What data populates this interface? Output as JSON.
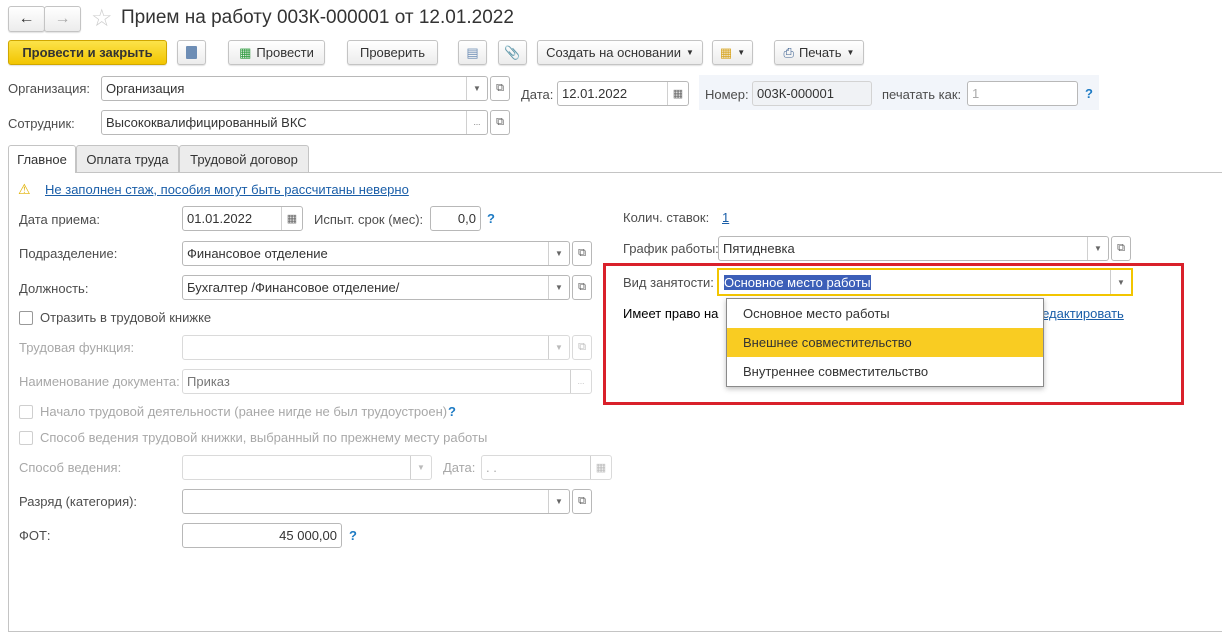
{
  "window": {
    "title": "Прием на работу 003К-000001 от 12.01.2022"
  },
  "toolbar": {
    "post_close": "Провести и закрыть",
    "post": "Провести",
    "check": "Проверить",
    "create_based": "Создать на основании",
    "print": "Печать"
  },
  "header": {
    "org_label": "Организация:",
    "org_value": "Организация",
    "date_label": "Дата:",
    "date_value": "12.01.2022",
    "number_label": "Номер:",
    "number_value": "003К-000001",
    "print_as_label": "печатать как:",
    "print_as_placeholder": "1",
    "help": "?",
    "employee_label": "Сотрудник:",
    "employee_value": "Высококвалифицированный ВКС"
  },
  "tabs": [
    {
      "label": "Главное"
    },
    {
      "label": "Оплата труда"
    },
    {
      "label": "Трудовой договор"
    }
  ],
  "main": {
    "warning": "Не заполнен стаж, пособия могут быть рассчитаны неверно",
    "hire_date_label": "Дата приема:",
    "hire_date": "01.01.2022",
    "probation_label": "Испыт. срок (мес):",
    "probation": "0,0",
    "dept_label": "Подразделение:",
    "dept": "Финансовое отделение",
    "position_label": "Должность:",
    "position": "Бухгалтер /Финансовое отделение/",
    "reflect_label": "Отразить в трудовой книжке",
    "labor_func_label": "Трудовая функция:",
    "doc_name_label": "Наименование документа:",
    "doc_name": "Приказ",
    "first_job_label": "Начало трудовой деятельности (ранее нигде не был трудоустроен)",
    "book_method_prev_label": "Способ ведения трудовой книжки, выбранный по прежнему месту работы",
    "method_label": "Способ ведения:",
    "method_date_label": "Дата:",
    "method_date": " .  .",
    "rank_label": "Разряд (категория):",
    "fot_label": "ФОТ:",
    "fot": "45 000,00",
    "rates_label": "Колич. ставок:",
    "rates": "1",
    "schedule_label": "График работы:",
    "schedule": "Пятидневка",
    "employment_label": "Вид занятости:",
    "employment": "Основное место работы",
    "entitled_label": "Имеет право на",
    "edit_link": "Редактировать",
    "employment_options": [
      "Основное место работы",
      "Внешнее совместительство",
      "Внутреннее совместительство"
    ],
    "highlight_index": 1
  },
  "colors": {
    "accent": "#f2c500",
    "highlight": "#f9cc22",
    "frame": "#d9202a",
    "link": "#1a5ea8"
  }
}
